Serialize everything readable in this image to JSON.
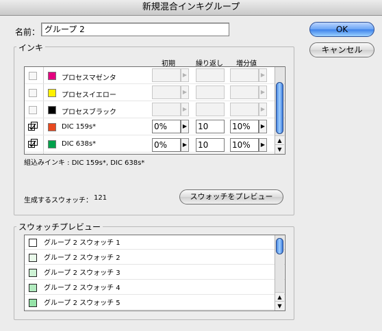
{
  "window": {
    "title": "新規混合インキグループ"
  },
  "name_field": {
    "label": "名前：",
    "value": "グループ 2"
  },
  "buttons": {
    "ok": "OK",
    "cancel": "キャンセル",
    "preview": "スウォッチをプレビュー"
  },
  "ink_group": {
    "title": "インキ",
    "headers": {
      "initial": "初期",
      "repeat": "繰り返し",
      "increment": "増分値"
    },
    "rows": [
      {
        "name": "プロセスマゼンタ",
        "color": "#e4007f",
        "active": false,
        "initial": "",
        "repeat": "",
        "increment": ""
      },
      {
        "name": "プロセスイエロー",
        "color": "#fff100",
        "active": false,
        "initial": "",
        "repeat": "",
        "increment": ""
      },
      {
        "name": "プロセスブラック",
        "color": "#000000",
        "active": false,
        "initial": "",
        "repeat": "",
        "increment": ""
      },
      {
        "name": "DIC 159s*",
        "color": "#e8491f",
        "active": true,
        "initial": "0%",
        "repeat": "10",
        "increment": "10%"
      },
      {
        "name": "DIC 638s*",
        "color": "#00a14b",
        "active": true,
        "initial": "0%",
        "repeat": "10",
        "increment": "10%"
      }
    ],
    "combined_text": "組込みインキ : DIC 159s*, DIC 638s*",
    "swatch_count_label": "生成するスウォッチ：",
    "swatch_count": "121"
  },
  "preview_group": {
    "title": "スウォッチプレビュー",
    "items": [
      {
        "label": "グループ 2 スウォッチ 1",
        "color": "#ffffff"
      },
      {
        "label": "グループ 2 スウォッチ 2",
        "color": "#e9f9ea"
      },
      {
        "label": "グループ 2 スウォッチ 3",
        "color": "#cdf2d4"
      },
      {
        "label": "グループ 2 スウォッチ 4",
        "color": "#b2ebbf"
      },
      {
        "label": "グループ 2 スウォッチ 5",
        "color": "#95e3a8"
      }
    ]
  },
  "icons": {
    "active_ink_icon": "ink-include-icon",
    "scroll_up": "▲",
    "scroll_down": "▼",
    "spin_arrow": "▶"
  }
}
